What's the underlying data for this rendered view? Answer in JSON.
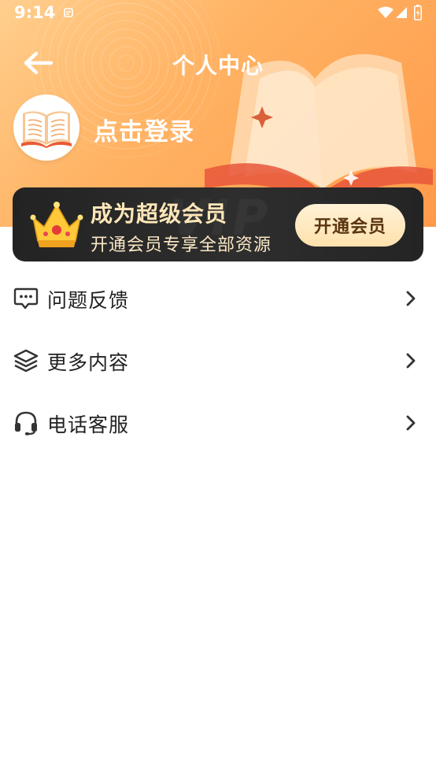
{
  "status_bar": {
    "time": "9:14"
  },
  "header": {
    "title": "个人中心",
    "back_icon": "arrow-left-icon"
  },
  "profile": {
    "login_text": "点击登录",
    "avatar_icon": "open-book-icon"
  },
  "vip_card": {
    "title": "成为超级会员",
    "subtitle": "开通会员专享全部资源",
    "button_label": "开通会员",
    "icon": "crown-icon"
  },
  "menu": {
    "items": [
      {
        "label": "问题反馈",
        "icon": "chat-bubble-icon"
      },
      {
        "label": "更多内容",
        "icon": "layers-icon"
      },
      {
        "label": "电话客服",
        "icon": "headset-icon"
      }
    ]
  },
  "colors": {
    "header_gradient_start": "#ffcf8e",
    "header_gradient_end": "#ff9a4a",
    "vip_card_bg": "#232323",
    "vip_text": "#ffe6b8",
    "vip_button_bg": "#ffe8bd",
    "vip_button_text": "#5a3510"
  }
}
